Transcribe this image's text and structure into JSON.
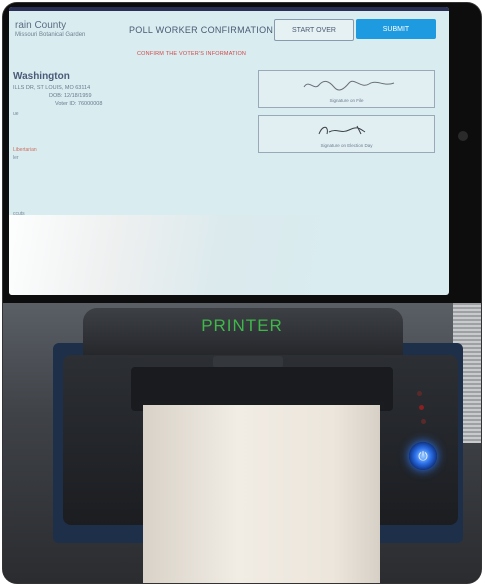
{
  "screen": {
    "county": "rain County",
    "subtitle": "Missouri Botanical Garden",
    "title": "POLL WORKER CONFIRMATION",
    "start_over": "START OVER",
    "submit": "SUBMIT",
    "confirm_message": "CONFIRM THE VOTER'S INFORMATION",
    "voter": {
      "name": "Washington",
      "address": "ILLS DR, ST LOUIS, MO 63114",
      "dob": "DOB: 12/18/1959",
      "voter_id": "Voter ID: 76000008"
    },
    "fragments": [
      "ue",
      "Libertarian",
      "ler",
      "ccuts"
    ],
    "signatures": [
      {
        "caption": "Signature on File"
      },
      {
        "caption": "Signature on Election Day"
      }
    ]
  },
  "printer": {
    "label": "PRINTER",
    "power_icon": "power-icon"
  }
}
